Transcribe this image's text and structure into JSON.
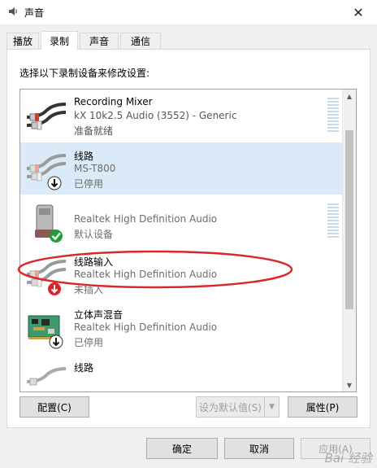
{
  "window": {
    "title": "声音",
    "close_label": "✕"
  },
  "tabs": [
    {
      "label": "播放",
      "active": false
    },
    {
      "label": "录制",
      "active": true
    },
    {
      "label": "声音",
      "active": false
    },
    {
      "label": "通信",
      "active": false
    }
  ],
  "panel": {
    "instruction": "选择以下录制设备来修改设置:"
  },
  "devices": [
    {
      "name": "Recording Mixer",
      "description": "kX 10k2.5 Audio (3552) - Generic",
      "status": "准备就绪",
      "icon": "rca-cable-icon",
      "badge": ""
    },
    {
      "name": "线路",
      "description": "MS-T800",
      "status": "已停用",
      "icon": "rca-cable-icon",
      "badge": "down-arrow-badge"
    },
    {
      "name": "",
      "description": "Realtek High Definition Audio",
      "status": "默认设备",
      "icon": "microphone-icon",
      "badge": "check-badge"
    },
    {
      "name": "线路输入",
      "description": "Realtek High Definition Audio",
      "status": "未插入",
      "icon": "rca-cable-icon",
      "badge": "red-arrow-badge"
    },
    {
      "name": "立体声混音",
      "description": "Realtek High Definition Audio",
      "status": "已停用",
      "icon": "circuit-board-icon",
      "badge": "down-arrow-badge"
    },
    {
      "name": "线路",
      "description": "",
      "status": "",
      "icon": "rca-cable-icon",
      "badge": ""
    }
  ],
  "buttons": {
    "configure": "配置(C)",
    "set_default": "设为默认值(S)",
    "properties": "属性(P)",
    "ok": "确定",
    "cancel": "取消",
    "apply": "应用(A)"
  },
  "watermark": "Bai 经验",
  "colors": {
    "selection": "#dbeaf8",
    "annotation": "#d9282b",
    "level_meter": "#c7dceb",
    "default_badge": "#1f9e3a"
  }
}
